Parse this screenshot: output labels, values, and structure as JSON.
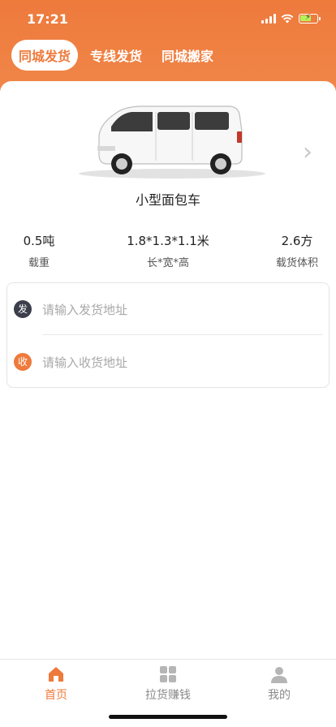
{
  "status_bar": {
    "time": "17:21"
  },
  "tabs": [
    {
      "label": "同城发货",
      "active": true
    },
    {
      "label": "专线发货",
      "active": false
    },
    {
      "label": "同城搬家",
      "active": false
    }
  ],
  "vehicle": {
    "name": "小型面包车",
    "specs": [
      {
        "value": "0.5吨",
        "label": "载重"
      },
      {
        "value": "1.8*1.3*1.1米",
        "label": "长*宽*高"
      },
      {
        "value": "2.6方",
        "label": "载货体积"
      }
    ]
  },
  "address": {
    "from_badge": "发",
    "from_placeholder": "请输入发货地址",
    "to_badge": "收",
    "to_placeholder": "请输入收货地址"
  },
  "tabbar": {
    "items": [
      {
        "label": "首页",
        "icon": "home-icon",
        "active": true
      },
      {
        "label": "拉货赚钱",
        "icon": "grid-icon",
        "active": false
      },
      {
        "label": "我的",
        "icon": "user-icon",
        "active": false
      }
    ]
  },
  "colors": {
    "accent": "#ee7a3c",
    "badge_dark": "#3b3f4c",
    "badge_orange": "#ee7a3c",
    "tab_inactive": "#8a8a8a"
  }
}
